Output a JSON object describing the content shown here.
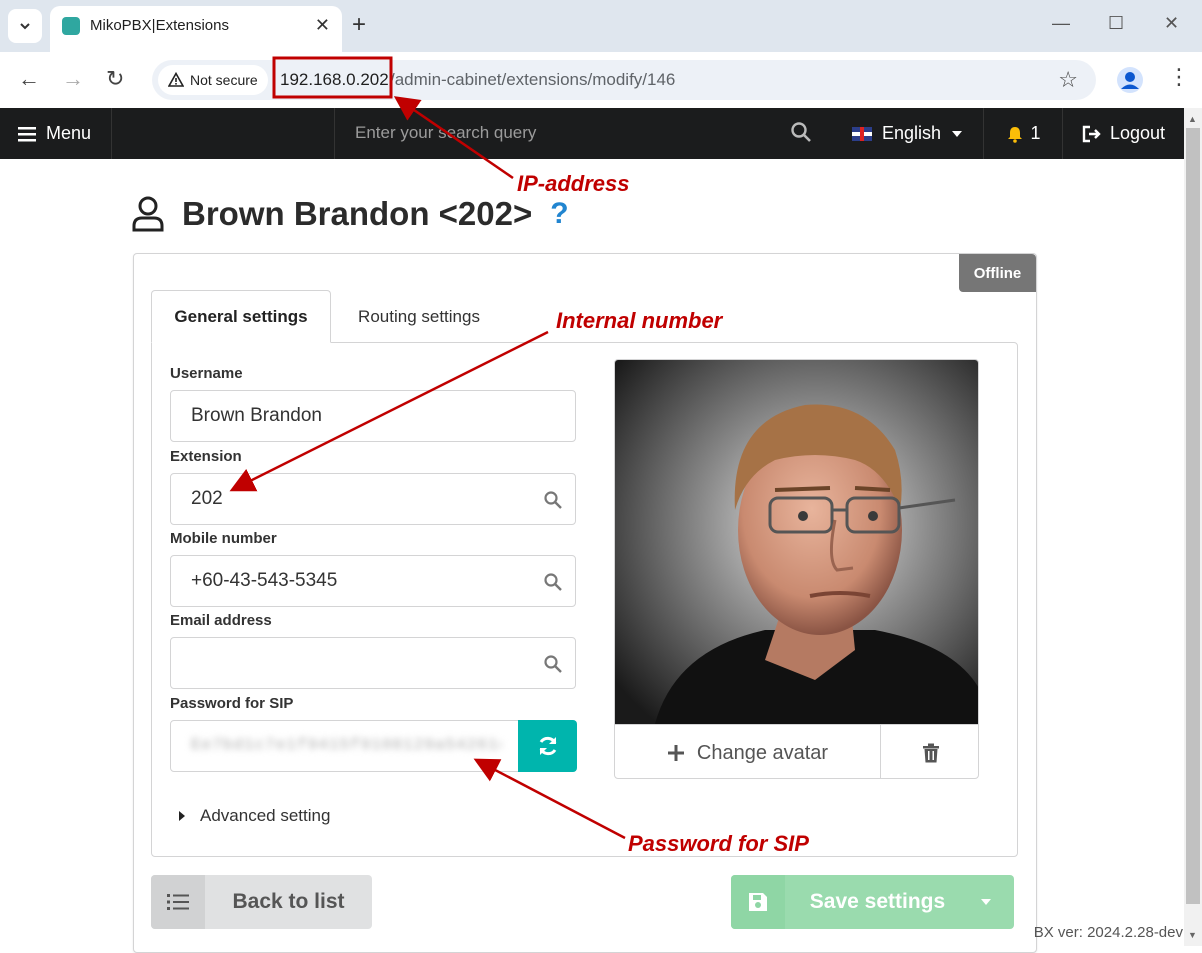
{
  "browser": {
    "tab_title": "MikoPBX|Extensions",
    "security_label": "Not secure",
    "url_host": "192.168.0.202",
    "url_path": "/admin-cabinet/extensions/modify/146"
  },
  "topbar": {
    "menu_label": "Menu",
    "search_placeholder": "Enter your search query",
    "language": "English",
    "notification_count": "1",
    "logout_label": "Logout"
  },
  "page": {
    "title": "Brown Brandon <202>",
    "help": "?",
    "status_badge": "Offline"
  },
  "tabs": [
    {
      "label": "General settings",
      "active": true
    },
    {
      "label": "Routing settings",
      "active": false
    }
  ],
  "form": {
    "username_label": "Username",
    "username_value": "Brown Brandon",
    "extension_label": "Extension",
    "extension_value": "202",
    "mobile_label": "Mobile number",
    "mobile_value": "+60-43-543-5345",
    "email_label": "Email address",
    "email_value": "",
    "password_label": "Password for SIP",
    "password_value": "Ee7bd1c7e1f9415f9108129a54261d",
    "advanced_label": "Advanced setting"
  },
  "avatar": {
    "change_label": "Change avatar"
  },
  "buttons": {
    "back_label": "Back to list",
    "save_label": "Save settings"
  },
  "footer": {
    "version": "BX ver: 2024.2.28-dev"
  },
  "annotations": {
    "ip": "IP-address",
    "internal": "Internal number",
    "password": "Password for SIP"
  },
  "colors": {
    "topbar": "#1b1c1d",
    "teal": "#00b5ad",
    "save_green": "#9adbae",
    "annotation_red": "#c00000",
    "help_blue": "#2185d0",
    "offline_grey": "#767676"
  }
}
